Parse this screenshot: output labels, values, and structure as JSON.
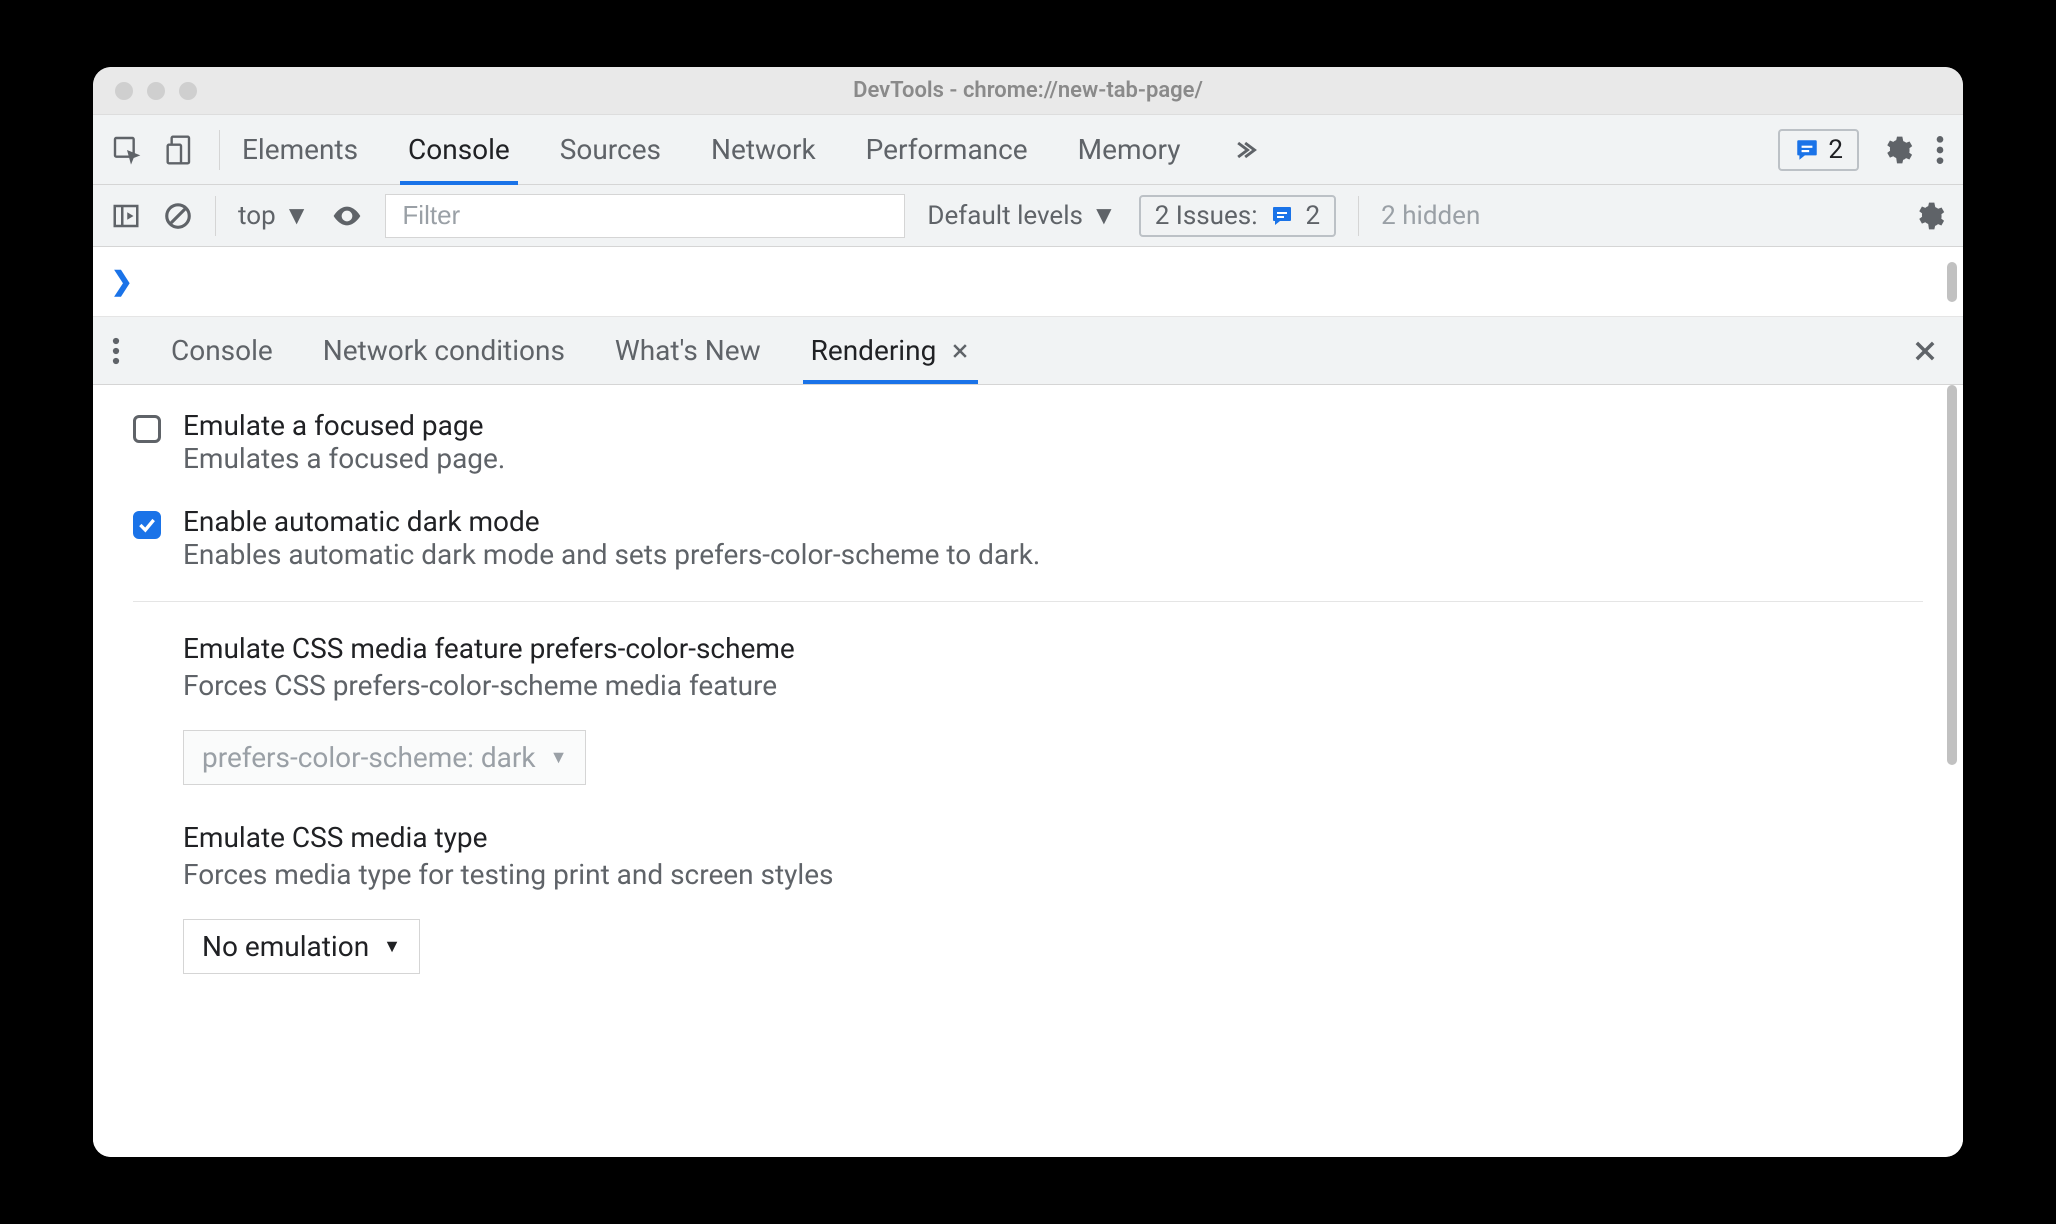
{
  "window": {
    "title": "DevTools - chrome://new-tab-page/"
  },
  "topbar": {
    "tabs": [
      "Elements",
      "Console",
      "Sources",
      "Network",
      "Performance",
      "Memory"
    ],
    "active_tab": "Console",
    "badge_count": "2"
  },
  "console_bar": {
    "context": "top",
    "filter_placeholder": "Filter",
    "levels": "Default levels",
    "issues_label": "2 Issues:",
    "issues_count": "2",
    "hidden": "2 hidden"
  },
  "drawer": {
    "tabs": [
      "Console",
      "Network conditions",
      "What's New",
      "Rendering"
    ],
    "active_tab": "Rendering"
  },
  "rendering": {
    "opt1": {
      "title": "Emulate a focused page",
      "desc": "Emulates a focused page.",
      "checked": false
    },
    "opt2": {
      "title": "Enable automatic dark mode",
      "desc": "Enables automatic dark mode and sets prefers-color-scheme to dark.",
      "checked": true
    },
    "sec1": {
      "title": "Emulate CSS media feature prefers-color-scheme",
      "desc": "Forces CSS prefers-color-scheme media feature",
      "select": "prefers-color-scheme: dark"
    },
    "sec2": {
      "title": "Emulate CSS media type",
      "desc": "Forces media type for testing print and screen styles",
      "select": "No emulation"
    }
  }
}
